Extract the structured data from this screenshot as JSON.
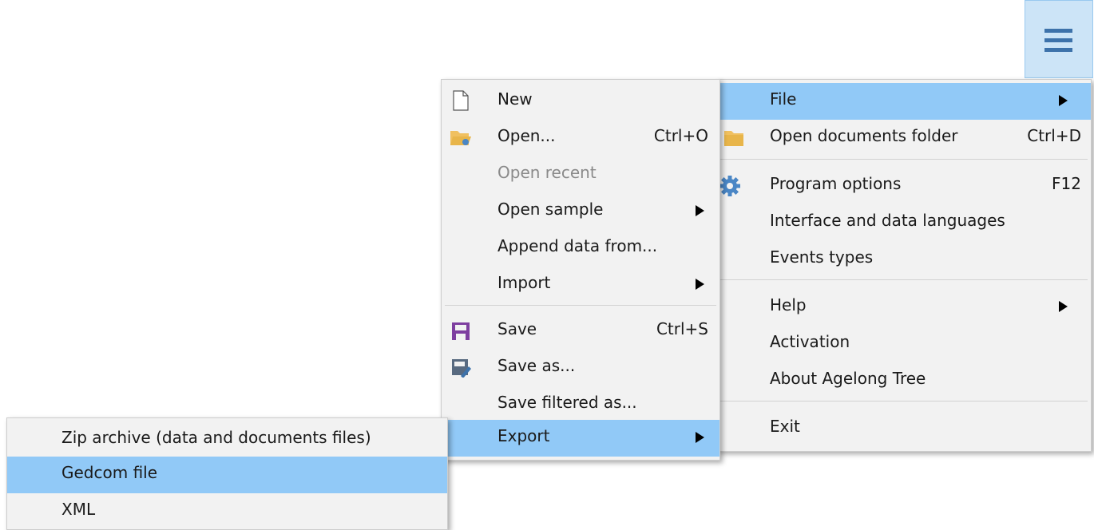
{
  "app_menu_button": {
    "icon": "hamburger-icon"
  },
  "main_menu": {
    "items": [
      {
        "label": "File",
        "has_submenu": true
      },
      {
        "label": "Open documents folder",
        "shortcut": "Ctrl+D",
        "icon": "folder-icon"
      },
      {
        "label": "Program options",
        "shortcut": "F12",
        "icon": "gear-icon"
      },
      {
        "label": "Interface and data languages"
      },
      {
        "label": "Events types"
      },
      {
        "label": "Help",
        "has_submenu": true
      },
      {
        "label": "Activation"
      },
      {
        "label": "About Agelong Tree"
      },
      {
        "label": "Exit"
      }
    ]
  },
  "file_menu": {
    "items": [
      {
        "label": "New",
        "icon": "new-document-icon"
      },
      {
        "label": "Open...",
        "shortcut": "Ctrl+O",
        "icon": "open-folder-icon"
      },
      {
        "label": "Open recent",
        "disabled": true
      },
      {
        "label": "Open sample",
        "has_submenu": true
      },
      {
        "label": "Append data from..."
      },
      {
        "label": "Import",
        "has_submenu": true
      },
      {
        "label": "Save",
        "shortcut": "Ctrl+S",
        "icon": "save-icon"
      },
      {
        "label": "Save as...",
        "icon": "save-as-icon"
      },
      {
        "label": "Save filtered as..."
      },
      {
        "label": "Export",
        "has_submenu": true
      }
    ]
  },
  "export_menu": {
    "items": [
      {
        "label": "Zip archive (data and documents files)"
      },
      {
        "label": "Gedcom file"
      },
      {
        "label": "XML"
      }
    ]
  },
  "colors": {
    "highlight": "#91c9f7",
    "menu_bg": "#f2f2f2",
    "hamburger_bg": "#cce4f7",
    "hamburger_bars": "#3d72aa"
  }
}
